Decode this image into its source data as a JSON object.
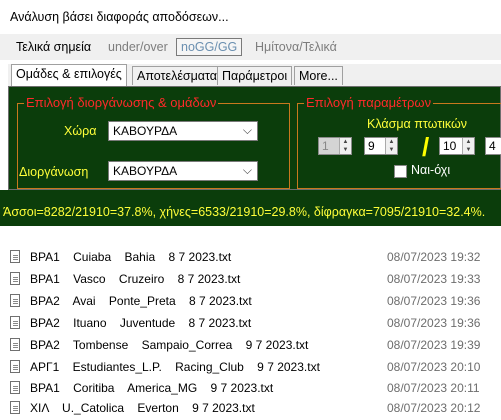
{
  "window": {
    "title": "Ανάλυση βάσει διαφοράς αποδόσεων..."
  },
  "menu": [
    "Τελικά σημεία",
    "under/over",
    "noGG/GG",
    "Ημίτονα/Τελικά"
  ],
  "tabs": [
    "Ομάδες & επιλογές",
    "Αποτελέσματα",
    "Παράμετροι",
    "More..."
  ],
  "group_teams": {
    "title": "Επιλογή διοργάνωσης & ομάδων",
    "country_label": "Χώρα",
    "country_value": "ΚΑΒΟΥΡΔΑ",
    "competition_label": "Διοργάνωση",
    "competition_value": "ΚΑΒΟΥΡΔΑ"
  },
  "group_params": {
    "title": "Επιλογή παραμέτρων",
    "fraction_label": "Κλάσμα πτωτικών",
    "spin_values": [
      "1",
      "9",
      "10",
      "4"
    ],
    "slash": "/",
    "checkbox_label": "Ναι-όχι"
  },
  "stats_line": "Άσσοι=8282/21910=37.8%, χήνες=6533/21910=29.8%, δίφραγκα=7095/21910=32.4%.",
  "files": [
    {
      "name": "BPA1    Cuiaba    Bahia    8 7 2023.txt",
      "date": "08/07/2023 19:32"
    },
    {
      "name": "BPA1    Vasco    Cruzeiro    8 7 2023.txt",
      "date": "08/07/2023 19:33"
    },
    {
      "name": "BPA2    Avai    Ponte_Preta    8 7 2023.txt",
      "date": "08/07/2023 19:36"
    },
    {
      "name": "BPA2    Ituano    Juventude    8 7 2023.txt",
      "date": "08/07/2023 19:36"
    },
    {
      "name": "BPA2    Tombense    Sampaio_Correa    9 7 2023.txt",
      "date": "08/07/2023 19:39"
    },
    {
      "name": "ΑΡΓ1    Estudiantes_L.P.    Racing_Club    9 7 2023.txt",
      "date": "08/07/2023 20:10"
    },
    {
      "name": "BPA1    Coritiba    America_MG    9 7 2023.txt",
      "date": "08/07/2023 20:11"
    },
    {
      "name": "ΧΙΛ    U._Catolica    Everton    9 7 2023.txt",
      "date": "08/07/2023 20:12"
    }
  ]
}
